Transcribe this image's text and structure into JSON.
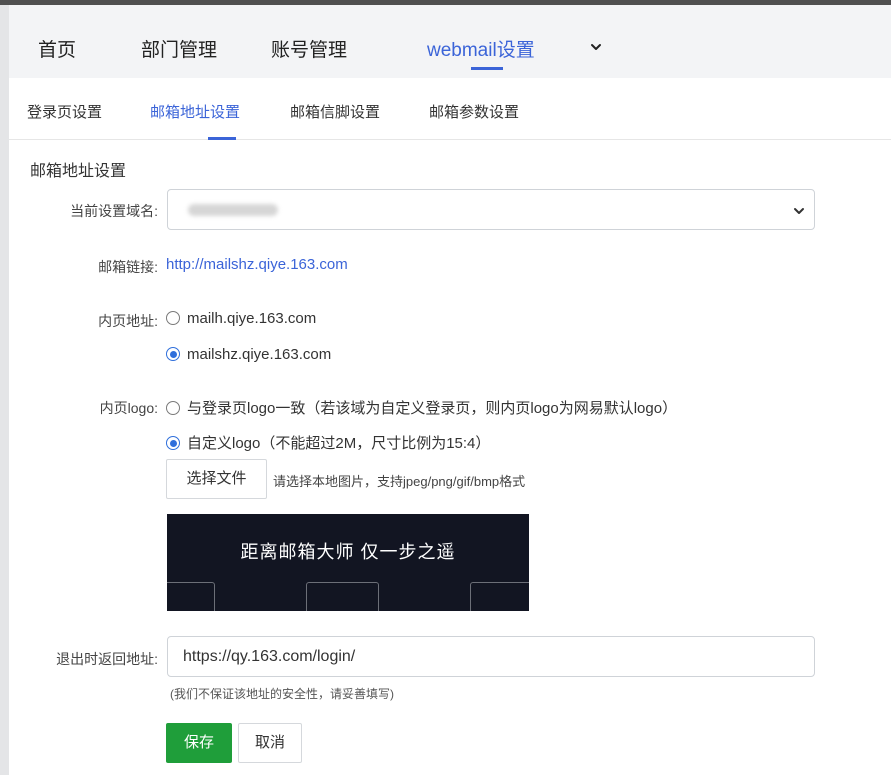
{
  "top_nav": {
    "items": [
      "首页",
      "部门管理",
      "账号管理",
      "webmail设置"
    ],
    "active_index": 3,
    "more_icon": "chevron-down-icon"
  },
  "sub_tabs": {
    "items": [
      "登录页设置",
      "邮箱地址设置",
      "邮箱信脚设置",
      "邮箱参数设置"
    ],
    "active_index": 1
  },
  "section": {
    "title": "邮箱地址设置"
  },
  "form": {
    "domain_label": "当前设置域名:",
    "mail_link_label": "邮箱链接:",
    "mail_link_value": "http://mailshz.qiye.163.com",
    "inner_address_label": "内页地址:",
    "inner_address_options": [
      "mailh.qiye.163.com",
      "mailshz.qiye.163.com"
    ],
    "inner_address_selected": 1,
    "inner_logo_label": "内页logo:",
    "inner_logo_options": [
      "与登录页logo一致（若该域为自定义登录页，则内页logo为网易默认logo）",
      "自定义logo（不能超过2M，尺寸比例为15:4）"
    ],
    "inner_logo_selected": 1,
    "file_button": "选择文件",
    "file_hint": "请选择本地图片，支持jpeg/png/gif/bmp格式",
    "preview_text": "距离邮箱大师 仅一步之遥",
    "logout_label": "退出时返回地址:",
    "logout_value": "https://qy.163.com/login/",
    "logout_note": "(我们不保证该地址的安全性，请妥善填写)",
    "save_button": "保存",
    "cancel_button": "取消"
  },
  "colors": {
    "accent": "#3b64d8",
    "save_green": "#1f9e3a",
    "preview_bg": "#121522"
  }
}
